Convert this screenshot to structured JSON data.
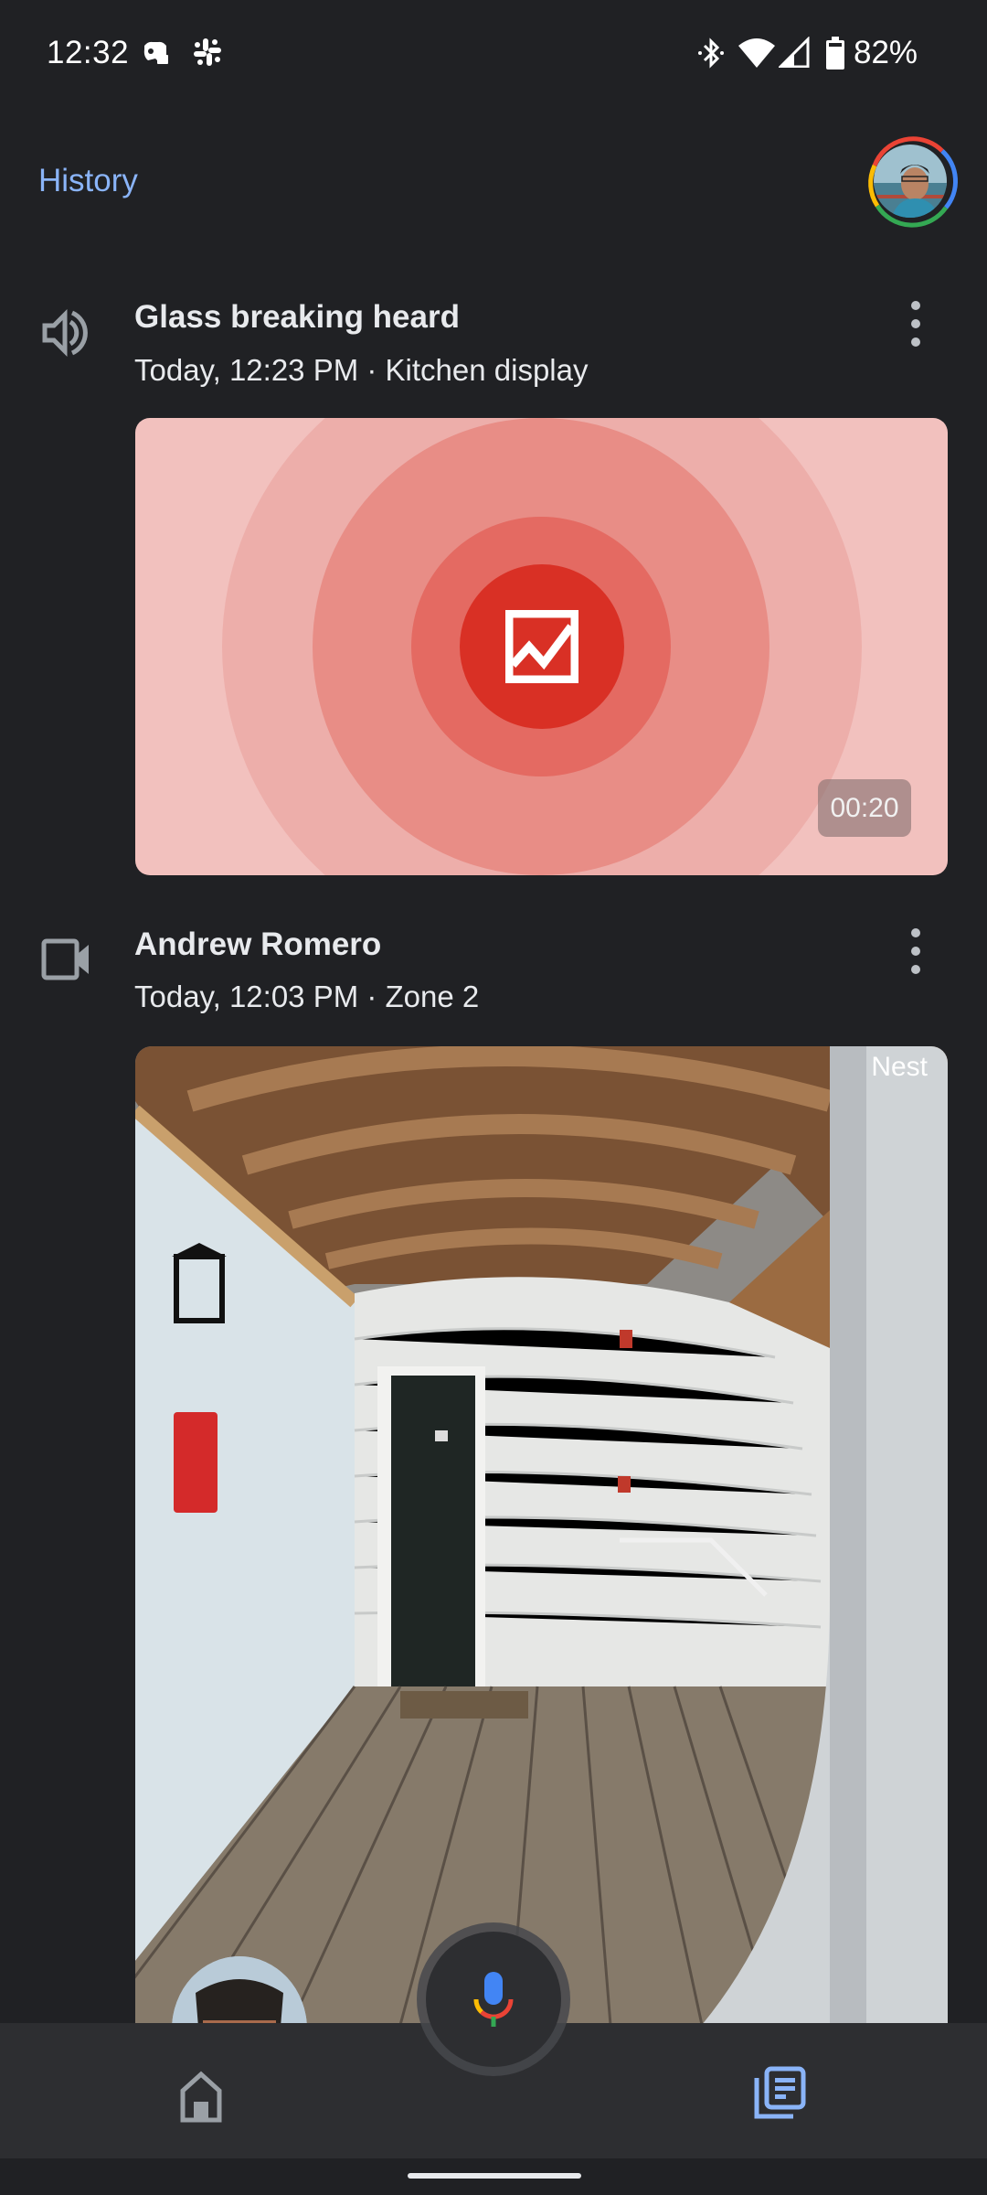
{
  "status_bar": {
    "time": "12:32",
    "notification_icons": [
      "discord-icon",
      "slack-icon"
    ],
    "system_icons": [
      "bluetooth-icon",
      "wifi-icon",
      "cell-signal-icon",
      "battery-icon"
    ],
    "battery_percent": "82%"
  },
  "header": {
    "title": "History",
    "avatar": "account-avatar"
  },
  "events": [
    {
      "icon": "speaker-icon",
      "title": "Glass breaking heard",
      "subtitle": "Today, 12:23 PM · Kitchen display",
      "media": {
        "type": "sound-visualization",
        "center_icon": "glass-break-icon",
        "duration": "00:20",
        "colors": [
          "#f2c1be",
          "#edaeaa",
          "#e88d86",
          "#e46a62",
          "#d93025"
        ]
      }
    },
    {
      "icon": "videocam-icon",
      "title": "Andrew Romero",
      "subtitle": "Today, 12:03 PM · Zone 2",
      "media": {
        "type": "camera-snapshot",
        "watermark": "Nest",
        "face_thumbnail": "familiar-face-thumbnail"
      }
    }
  ],
  "bottom_nav": {
    "items": [
      {
        "icon": "home-icon",
        "active": false
      },
      {
        "icon": "history-icon",
        "active": true
      }
    ],
    "fab_icon": "google-assistant-mic-icon",
    "active_color": "#8ab4f8",
    "inactive_color": "#9aa0a6"
  }
}
